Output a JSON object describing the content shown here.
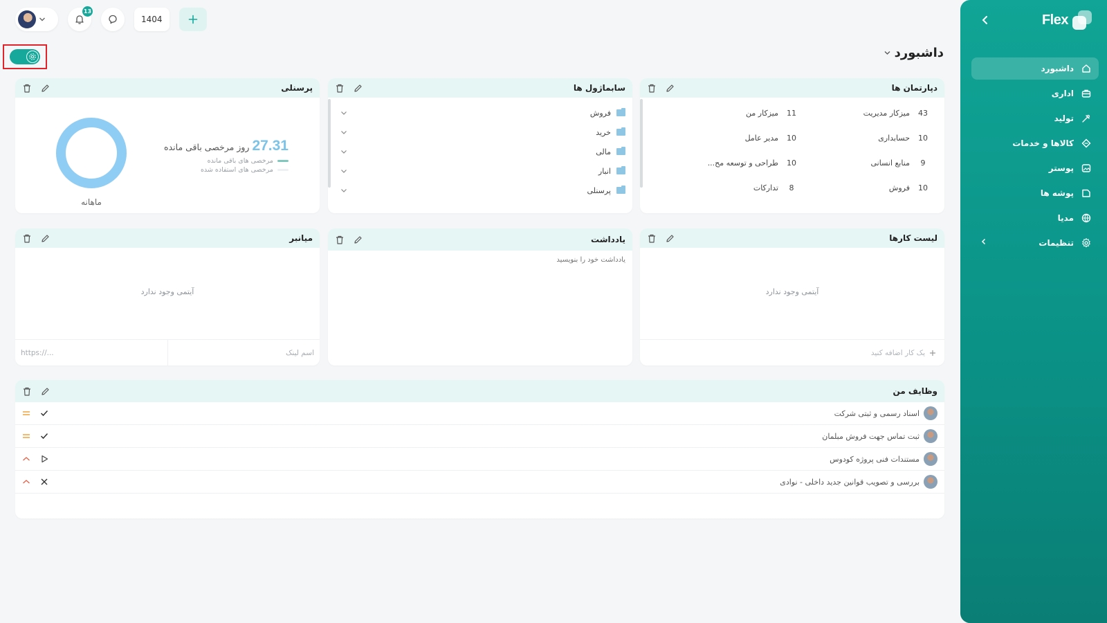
{
  "sidebar": {
    "logo_text": "Flex",
    "items": [
      {
        "label": "داشبورد",
        "icon": "home-icon",
        "active": true
      },
      {
        "label": "اداری",
        "icon": "briefcase-icon"
      },
      {
        "label": "تولید",
        "icon": "factory-icon"
      },
      {
        "label": "کالاها و خدمات",
        "icon": "diamond-icon"
      },
      {
        "label": "پوستر",
        "icon": "image-icon"
      },
      {
        "label": "پوشه ها",
        "icon": "folder-icon"
      },
      {
        "label": "مدیا",
        "icon": "globe-icon"
      },
      {
        "label": "تنظیمات",
        "icon": "gear-icon",
        "expandable": true
      }
    ]
  },
  "topbar": {
    "notification_count": "13",
    "year": "1404"
  },
  "page": {
    "title": "داشبورد"
  },
  "departments": {
    "title": "دپارتمان ها",
    "rows": [
      {
        "name": "میزکار مدیریت",
        "count": "43"
      },
      {
        "name": "میزکار من",
        "count": "11"
      },
      {
        "name": "حسابداری",
        "count": "10"
      },
      {
        "name": "مدیر عامل",
        "count": "10"
      },
      {
        "name": "منابع انسانی",
        "count": "9"
      },
      {
        "name": "طراحی و توسعه مح...",
        "count": "10"
      },
      {
        "name": "فروش",
        "count": "10"
      },
      {
        "name": "تدارکات",
        "count": "8"
      }
    ]
  },
  "subsidiaries": {
    "title": "سابماژول ها",
    "items": [
      "فروش",
      "خرید",
      "مالی",
      "انبار",
      "پرسنلی"
    ]
  },
  "personnel": {
    "title": "پرسنلی",
    "leave_value": "27.31",
    "leave_label": "روز مرخصی باقی مانده",
    "legend_remaining": "مرخصی های باقی مانده",
    "legend_used": "مرخصی های استفاده شده",
    "period": "ماهانه",
    "remaining_fraction": 1.0,
    "colors": {
      "remaining": "#90cdf4",
      "used": "#e8edf1"
    }
  },
  "todo": {
    "title": "لیست کارها",
    "empty": "آیتمی وجود ندارد",
    "add_placeholder": "یک کار اضافه کنید"
  },
  "notes": {
    "title": "یادداشت",
    "placeholder": "یادداشت خود را بنویسید"
  },
  "shortcuts": {
    "title": "میانبر",
    "empty": "آیتمی وجود ندارد",
    "name_placeholder": "اسم لینک",
    "url_placeholder": "https://..."
  },
  "tasks": {
    "title": "وظایف من",
    "items": [
      {
        "title": "اسناد رسمی و ثبتی شرکت",
        "status": "done",
        "priority": "medium"
      },
      {
        "title": "ثبت تماس جهت فروش مبلمان",
        "status": "done",
        "priority": "medium"
      },
      {
        "title": "مستندات فنی پروژه کودوس",
        "status": "in-progress",
        "priority": "high"
      },
      {
        "title": "بررسی و تصویب قوانین جدید داخلی - نوادی",
        "status": "cancelled",
        "priority": "high"
      }
    ]
  },
  "colors": {
    "accent": "#16a89a",
    "card_header": "#e6f6f5",
    "priority_medium": "#f0a23a",
    "priority_high": "#e5634b"
  }
}
